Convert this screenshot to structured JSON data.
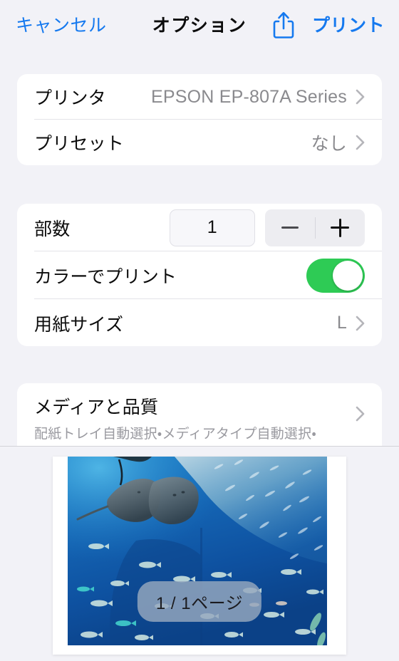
{
  "header": {
    "cancel_label": "キャンセル",
    "title": "オプション",
    "share_icon": "share-icon",
    "print_label": "プリント",
    "accent_color": "#1579EF"
  },
  "printer_section": {
    "rows": [
      {
        "label": "プリンタ",
        "value": "EPSON EP-807A Series",
        "accessory": "chevron-right-icon"
      },
      {
        "label": "プリセット",
        "value": "なし",
        "accessory": "chevron-right-icon"
      }
    ]
  },
  "settings_section": {
    "copies": {
      "label": "部数",
      "value": "1",
      "decrement_icon": "minus-icon",
      "increment_icon": "plus-icon"
    },
    "color_print": {
      "label": "カラーでプリント",
      "state": "on",
      "on_color": "#2ECB55"
    },
    "paper_size": {
      "label": "用紙サイズ",
      "value": "L",
      "accessory": "chevron-right-icon"
    }
  },
  "media_section": {
    "title": "メディアと品質",
    "subtitle": "配紙トレイ自動選択・メディアタイプ自動選択・",
    "accessory": "chevron-right-icon"
  },
  "preview": {
    "page_badge": "1 / 1ページ",
    "image_description": "aquarium-photo-stingrays-and-fish-school"
  }
}
